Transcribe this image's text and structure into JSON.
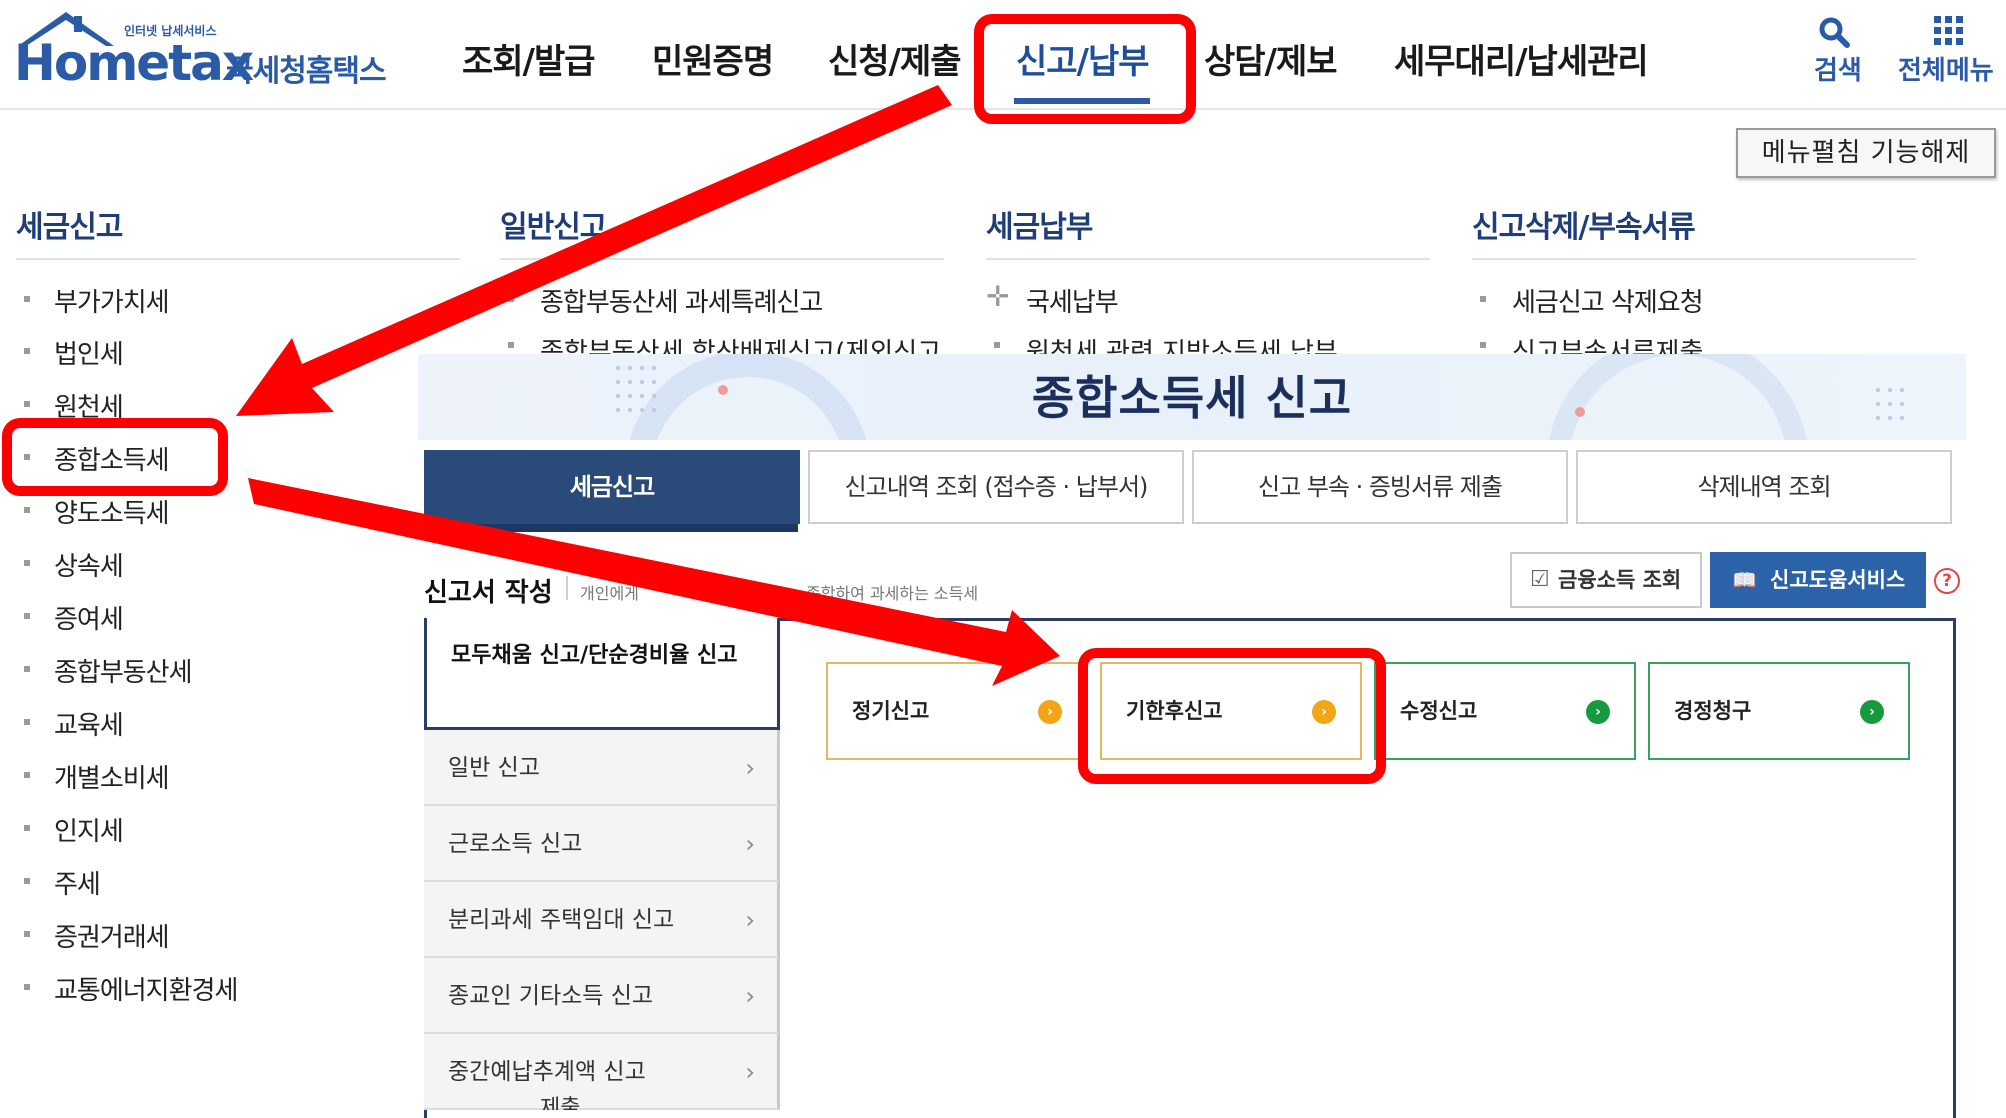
{
  "header": {
    "logo": {
      "tagline": "인터넷 납세서비스",
      "brand": "Hometax",
      "suffix": "국세청홈택스"
    },
    "nav": [
      {
        "label": "조회/발급"
      },
      {
        "label": "민원증명"
      },
      {
        "label": "신청/제출"
      },
      {
        "label": "신고/납부",
        "active": true
      },
      {
        "label": "상담/제보"
      },
      {
        "label": "세무대리/납세관리"
      }
    ],
    "search_label": "검색",
    "all_menu_label": "전체메뉴"
  },
  "menu_toggle_label": "메뉴펼침 기능해제",
  "mega_menu": {
    "columns": [
      {
        "heading": "세금신고",
        "items": [
          "부가가치세",
          "법인세",
          "원천세",
          "종합소득세",
          "양도소득세",
          "상속세",
          "증여세",
          "종합부동산세",
          "교육세",
          "개별소비세",
          "인지세",
          "주세",
          "증권거래세",
          "교통에너지환경세"
        ]
      },
      {
        "heading": "일반신고",
        "items": [
          "종합부동산세 과세특례신고",
          "종합부동산세 합산배제신고(제외신고"
        ]
      },
      {
        "heading": "세금납부",
        "items": [
          "국세납부",
          "원천세 관련 지방소득세 납부"
        ]
      },
      {
        "heading": "신고삭제/부속서류",
        "items": [
          "세금신고 삭제요청",
          "신고부속서류제출"
        ]
      }
    ]
  },
  "panel": {
    "title": "종합소득세 신고",
    "tabs": [
      {
        "label": "세금신고",
        "active": true
      },
      {
        "label": "신고내역 조회 (접수증 · 납부서)"
      },
      {
        "label": "신고 부속 · 증빙서류 제출"
      },
      {
        "label": "삭제내역 조회"
      }
    ],
    "form_title": "신고서 작성",
    "form_desc_left": "개인에게",
    "form_desc_right": "종합하여 과세하는 소득세",
    "financial_income_button": "금융소득 조회",
    "report_help_button": "신고도움서비스",
    "help_icon": "?",
    "side_menu": [
      {
        "label": "모두채움 신고/단순경비율 신고",
        "active": true
      },
      {
        "label": "일반 신고"
      },
      {
        "label": "근로소득 신고"
      },
      {
        "label": "분리과세 주택임대 신고"
      },
      {
        "label": "종교인 기타소득 신고"
      },
      {
        "label": "중간예납추계액 신고"
      }
    ],
    "side_overflow_text": "제출",
    "chevron": "›",
    "cards": [
      {
        "label": "정기신고",
        "style": "orange"
      },
      {
        "label": "기한후신고",
        "style": "orange",
        "highlighted": true
      },
      {
        "label": "수정신고",
        "style": "green"
      },
      {
        "label": "경정청구",
        "style": "green"
      }
    ]
  },
  "annotation": {
    "highlight_color": "#ff0000"
  }
}
